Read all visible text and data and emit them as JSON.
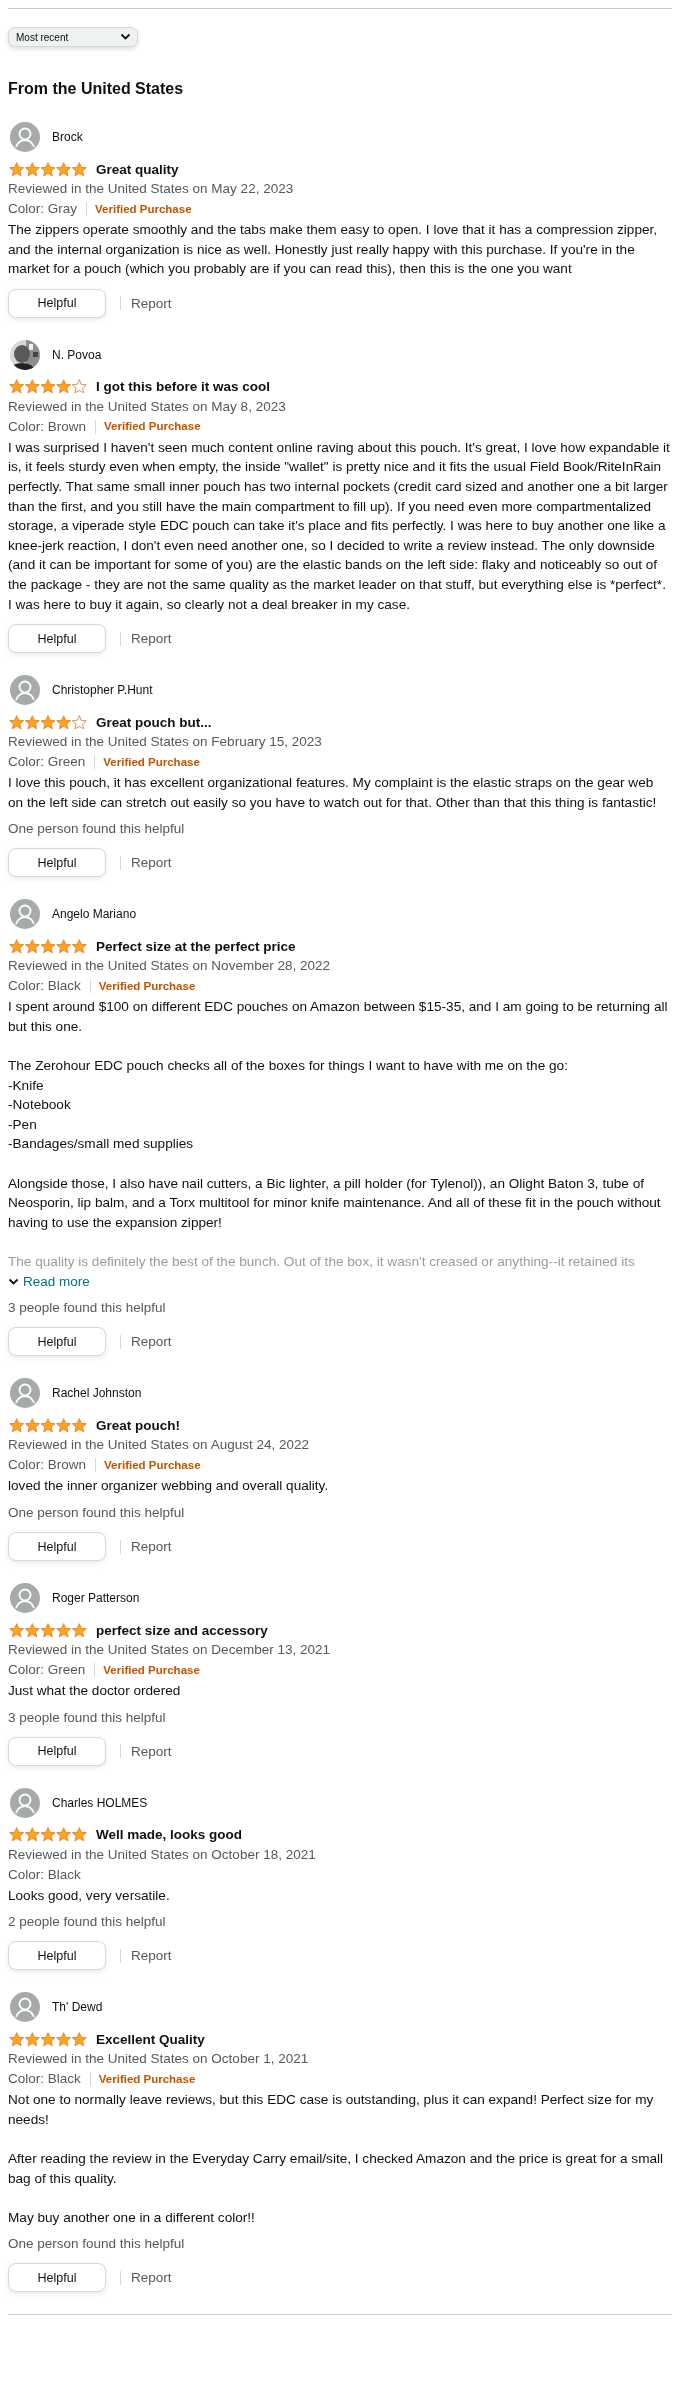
{
  "sort": {
    "value": "Most recent"
  },
  "heading": "From the United States",
  "reviews": [
    {
      "author": "Brock",
      "avatar": {
        "kind": "default"
      },
      "stars": 5,
      "title": "Great quality",
      "date": "Reviewed in the United States on May 22, 2023",
      "color_option": "Color: Gray",
      "verified": "Verified Purchase",
      "body": [
        "The zippers operate smoothly and the tabs make them easy to open. I love that it has a compression zipper, and the internal organization is nice as well. Honestly just really happy with this purchase. If you're in the market for a pouch (which you probably are if you can read this), then this is the one you want"
      ],
      "helpful_button": "Helpful",
      "report": "Report"
    },
    {
      "author": "N. Povoa",
      "stars": 4,
      "title": "I got this before it was cool",
      "date": "Reviewed in the United States on May 8, 2023",
      "color_option": "Color: Brown",
      "verified": "Verified Purchase",
      "body": [
        "I was surprised I haven't seen much content online raving about this pouch. It's great, I love how expandable it is, it feels sturdy even when empty, the inside \"wallet\" is pretty nice and it fits the usual Field Book/RiteInRain perfectly. That same small inner pouch has two internal pockets (credit card sized and another one a bit larger than the first, and you still have the main compartment to fill up). If you need even more compartmentalized storage, a viperade style EDC pouch can take it's place and fits perfectly. I was here to buy another one like a knee-jerk reaction, I don't even need another one, so I decided to write a review instead. The only downside (and it can be important for some of you) are the elastic bands on the left side: flaky and noticeably so out of the package - they are not the same quality as the market leader on that stuff, but everything else is *perfect*. I was here to buy it again, so clearly not a deal breaker in my case."
      ],
      "helpful_button": "Helpful",
      "report": "Report"
    },
    {
      "author": "Christopher P.Hunt",
      "avatar": {
        "kind": "default"
      },
      "stars": 4,
      "title": "Great pouch but...",
      "date": "Reviewed in the United States on February 15, 2023",
      "color_option": "Color: Green",
      "verified": "Verified Purchase",
      "body": [
        "I love this pouch, it has excellent organizational features. My complaint is the elastic straps on the gear web on the left side can stretch out easily so you have to watch out for that. Other than that this thing is fantastic!"
      ],
      "helpful_count": "One person found this helpful",
      "helpful_button": "Helpful",
      "report": "Report"
    },
    {
      "author": "Angelo Mariano",
      "avatar": {
        "kind": "default"
      },
      "stars": 5,
      "title": "Perfect size at the perfect price",
      "date": "Reviewed in the United States on November 28, 2022",
      "color_option": "Color: Black",
      "verified": "Verified Purchase",
      "body": [
        "I spent around $100 on different EDC pouches on Amazon between $15-35, and I am going to be returning all but this one.",
        "The Zerohour EDC pouch checks all of the boxes for things I want to have with me on the go:\n-Knife\n-Notebook\n-Pen\n-Bandages/small med supplies",
        "Alongside those, I also have nail cutters, a Bic lighter, a pill holder (for Tylenol)), an Olight Baton 3, tube of Neosporin, lip balm, and a Torx multitool for minor knife maintenance. And all of these fit in the pouch without having to use the expansion zipper!"
      ],
      "faded_line": "The quality is definitely the best of the bunch. Out of the box, it wasn't creased or anything--it retained its",
      "read_more": "Read more",
      "helpful_count": "3 people found this helpful",
      "helpful_button": "Helpful",
      "report": "Report"
    },
    {
      "author": "Rachel Johnston",
      "avatar": {
        "kind": "default"
      },
      "stars": 5,
      "title": "Great pouch!",
      "date": "Reviewed in the United States on August 24, 2022",
      "color_option": "Color: Brown",
      "verified": "Verified Purchase",
      "body": [
        "loved the inner organizer webbing and overall quality."
      ],
      "helpful_count": "One person found this helpful",
      "helpful_button": "Helpful",
      "report": "Report"
    },
    {
      "author": "Roger Patterson",
      "avatar": {
        "kind": "default"
      },
      "stars": 5,
      "title": "perfect size and accessory",
      "date": "Reviewed in the United States on December 13, 2021",
      "color_option": "Color: Green",
      "verified": "Verified Purchase",
      "body": [
        "Just what the doctor ordered"
      ],
      "helpful_count": "3 people found this helpful",
      "helpful_button": "Helpful",
      "report": "Report"
    },
    {
      "author": "Charles HOLMES",
      "avatar": {
        "kind": "default"
      },
      "stars": 5,
      "title": "Well made, looks good",
      "date": "Reviewed in the United States on October 18, 2021",
      "color_option": "Color: Black",
      "body": [
        "Looks good, very versatile."
      ],
      "helpful_count": "2 people found this helpful",
      "helpful_button": "Helpful",
      "report": "Report"
    },
    {
      "author": "Th' Dewd",
      "avatar": {
        "kind": "default"
      },
      "stars": 5,
      "title": "Excellent Quality",
      "date": "Reviewed in the United States on October 1, 2021",
      "color_option": "Color: Black",
      "verified": "Verified Purchase",
      "body": [
        "Not one to normally leave reviews, but this EDC case is outstanding, plus it can expand! Perfect size for my needs!",
        "After reading the review in the Everyday Carry email/site, I checked Amazon and the price is great for a small bag of this quality.",
        "May buy another one in a different color!!"
      ],
      "helpful_count": "One person found this helpful",
      "helpful_button": "Helpful",
      "report": "Report"
    }
  ]
}
